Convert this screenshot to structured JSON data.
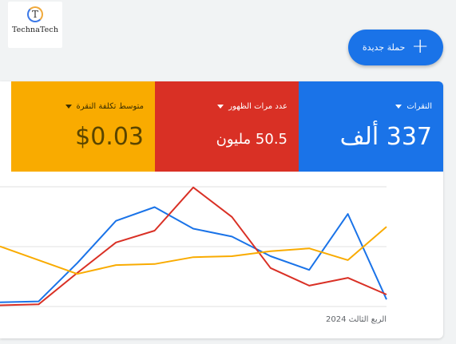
{
  "brand": {
    "initial": "T",
    "name": "TechnaTech"
  },
  "new_campaign": {
    "label": "حملة جديدة",
    "icon": "plus-icon"
  },
  "metrics": {
    "clicks": {
      "label": "النقرات",
      "value": "337 ألف",
      "color": "#1a73e8"
    },
    "impressions": {
      "label": "عدد مرات الظهور",
      "value": "50.5 مليون",
      "color": "#d93025"
    },
    "avg_cpc": {
      "label": "متوسط تكلفة النقرة",
      "value": "$0.03",
      "color": "#f9ab00"
    }
  },
  "chart_data": {
    "type": "line",
    "x_label": "الربع الثالث 2024",
    "grid": true,
    "series": [
      {
        "name": "النقرات",
        "color": "#1a73e8",
        "values": [
          5,
          6,
          45,
          88,
          102,
          80,
          72,
          52,
          38,
          95,
          8
        ]
      },
      {
        "name": "عدد مرات الظهور",
        "color": "#d93025",
        "values": [
          2,
          3,
          35,
          66,
          78,
          122,
          92,
          40,
          22,
          30,
          13
        ]
      },
      {
        "name": "متوسط تكلفة النقرة",
        "color": "#f9ab00",
        "values": [
          62,
          48,
          34,
          43,
          44,
          51,
          52,
          57,
          60,
          48,
          82
        ]
      }
    ]
  }
}
